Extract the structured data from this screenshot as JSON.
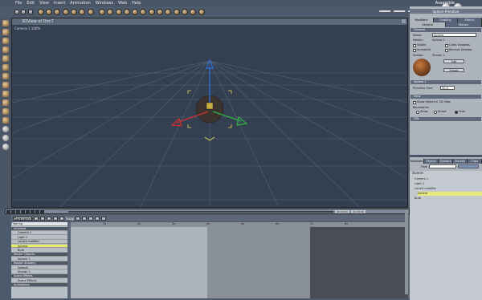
{
  "menu": [
    "File",
    "Edit",
    "View",
    "Insert",
    "Animation",
    "Windows",
    "Web",
    "Help"
  ],
  "workspace_label": "Assemble",
  "viewport": {
    "title": "3DView of Doc7",
    "camera_label": "Camera 1 100%"
  },
  "right_panel": {
    "header": "Sphere Primitive",
    "tabs_top": [
      "Modifiers",
      "Shading",
      "Effects"
    ],
    "tabs_second": [
      "General",
      "Motion"
    ],
    "section_general": "General",
    "name_label": "Name:",
    "name_value": "Sphere",
    "master_label": "Master:",
    "master_value": "Sphere 1",
    "chk_visible": "Visible",
    "chk_cast": "Casts shadows",
    "chk_animated": "Animated",
    "chk_receive": "Receive Shadow",
    "shader_label": "Shader:",
    "shader_value": "Shader 1",
    "edit_btn": "Edit",
    "preset_btn": "Preset",
    "section_sphere": "Sphere 1",
    "primitive_size_label": "Primitive Size:",
    "primitive_size_value": "50.0",
    "section_view": "View",
    "show_object": "Show Object in 3D View",
    "boundaries": "Boundaries",
    "r_show": "Show",
    "r_smart": "Smart",
    "r_hide": "Hide",
    "section_url": "URL",
    "scene_tabs": [
      "Hotshots",
      "Objects",
      "Shaders",
      "Sounds",
      "Clips"
    ],
    "find_label": "Find:",
    "scene_title": "Scene",
    "scene_items": [
      "Camera 1",
      "Light 1",
      "Local4 modifier",
      "Sphere",
      "Bulb"
    ]
  },
  "timeline": {
    "frame_start": "00:00:00",
    "frame_end": "00:00:00",
    "sequencer_label": "Sequencer",
    "filtering_label": "Filtering",
    "snap_label": "Snap",
    "tracks": [
      {
        "label": "Universe",
        "type": "h"
      },
      {
        "label": "Camera 1",
        "type": "n"
      },
      {
        "label": "Light 1",
        "type": "n"
      },
      {
        "label": "Local4 modifier",
        "type": "n"
      },
      {
        "label": "Sphere",
        "type": "sel"
      },
      {
        "label": "Bulb",
        "type": "n"
      },
      {
        "label": "Master Objects",
        "type": "h"
      },
      {
        "label": "Sphere 1",
        "type": "n"
      },
      {
        "label": "Master Shaders",
        "type": "h"
      },
      {
        "label": "Default",
        "type": "n"
      },
      {
        "label": "Shader 1",
        "type": "n"
      },
      {
        "label": "Scene Effects",
        "type": "h"
      },
      {
        "label": "Scene Effects",
        "type": "n"
      },
      {
        "label": "Animations",
        "type": "h"
      }
    ],
    "ruler_labels": [
      "1s",
      "2s",
      "3s",
      "4s",
      "5s",
      "6s",
      "7s",
      "8s"
    ]
  },
  "colors": {
    "x_axis": "#d03030",
    "y_axis": "#3070d0",
    "z_axis": "#30b040",
    "handle": "#e8e050"
  }
}
